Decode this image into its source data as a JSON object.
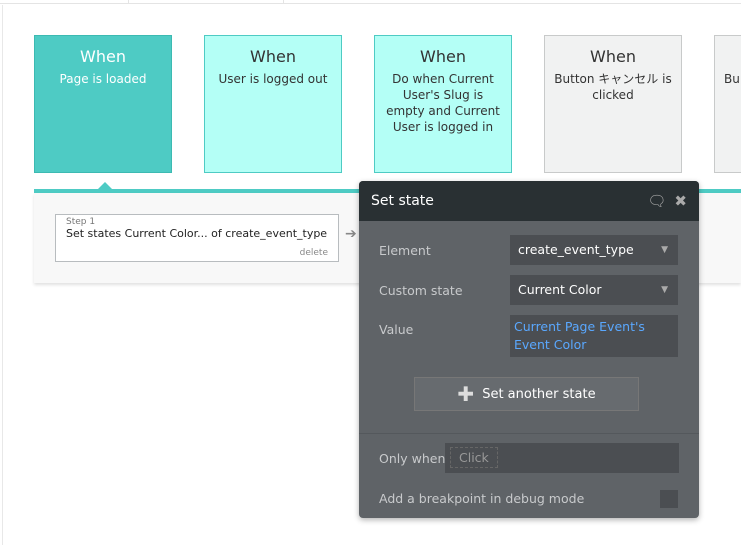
{
  "events": [
    {
      "when": "When",
      "desc": "Page is loaded",
      "bg": "#4ecbc4",
      "border": "#3cbab2",
      "color": "#ffffff"
    },
    {
      "when": "When",
      "desc": "User is logged out",
      "bg": "#b4fff6",
      "border": "#4ecbc4",
      "color": "#333333"
    },
    {
      "when": "When",
      "desc": "Do when Current User's Slug is empty and Current User is logged in",
      "bg": "#b4fff6",
      "border": "#4ecbc4",
      "color": "#333333"
    },
    {
      "when": "When",
      "desc": "Button キャンセル is clicked",
      "bg": "#f1f2f2",
      "border": "#c8caca",
      "color": "#333333"
    },
    {
      "when": "",
      "desc": "Bu",
      "bg": "#f1f2f2",
      "border": "#c8caca",
      "color": "#333333"
    }
  ],
  "step": {
    "number": "Step 1",
    "text": "Set states Current Color... of create_event_type",
    "delete": "delete"
  },
  "popup": {
    "title": "Set state",
    "element_label": "Element",
    "element_value": "create_event_type",
    "custom_state_label": "Custom state",
    "custom_state_value": "Current Color",
    "value_label": "Value",
    "value_value": "Current Page Event's Event Color",
    "add_button": "Set another state",
    "only_when_label": "Only when",
    "only_when_placeholder": "Click",
    "breakpoint_label": "Add a breakpoint in debug mode"
  },
  "colors": {
    "accent": "#4ecbc4",
    "dynamic_value": "#5aa8ff"
  }
}
